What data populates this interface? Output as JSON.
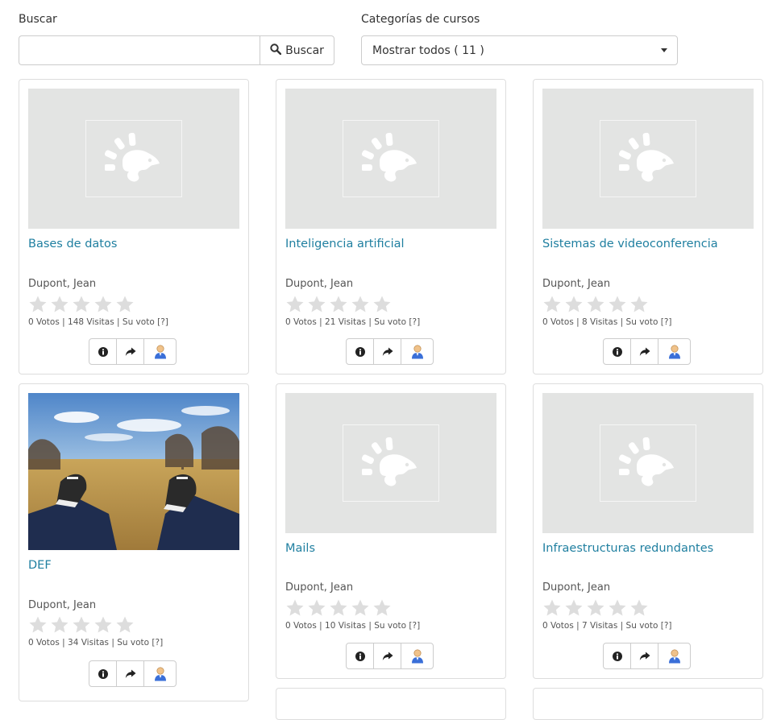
{
  "search": {
    "label": "Buscar",
    "value": "",
    "placeholder": "",
    "button_label": "Buscar"
  },
  "categories": {
    "label": "Categorías de cursos",
    "selected": "Mostrar todos ( 11 )"
  },
  "courses": [
    {
      "title": "Bases de datos",
      "teacher": "Dupont, Jean",
      "rating": 0,
      "stats_prefix": "0 Votos | 148 Visitas | Su voto",
      "help": "[?]",
      "image": "placeholder"
    },
    {
      "title": "Inteligencia artificial",
      "teacher": "Dupont, Jean",
      "rating": 0,
      "stats_prefix": "0 Votos | 21 Visitas | Su voto",
      "help": "[?]",
      "image": "placeholder"
    },
    {
      "title": "Sistemas de videoconferencia",
      "teacher": "Dupont, Jean",
      "rating": 0,
      "stats_prefix": "0 Votos | 8 Visitas | Su voto",
      "help": "[?]",
      "image": "placeholder"
    },
    {
      "title": "DEF",
      "teacher": "Dupont, Jean",
      "rating": 0,
      "stats_prefix": "0 Votos | 34 Visitas | Su voto",
      "help": "[?]",
      "image": "photo-sneakers-field"
    },
    {
      "title": "Mails",
      "teacher": "Dupont, Jean",
      "rating": 0,
      "stats_prefix": "0 Votos | 10 Visitas | Su voto",
      "help": "[?]",
      "image": "placeholder"
    },
    {
      "title": "Infraestructuras redundantes",
      "teacher": "Dupont, Jean",
      "rating": 0,
      "stats_prefix": "0 Votos | 7 Visitas | Su voto",
      "help": "[?]",
      "image": "placeholder"
    }
  ],
  "icons": {
    "search": "search-icon",
    "info": "info-icon",
    "share": "share-icon",
    "user": "user-icon",
    "placeholder": "chamilo-logo-icon",
    "star": "star-icon"
  },
  "colors": {
    "link": "#1f7fa0",
    "placeholder_bg": "#e3e4e3",
    "star_empty": "#dddddd"
  }
}
